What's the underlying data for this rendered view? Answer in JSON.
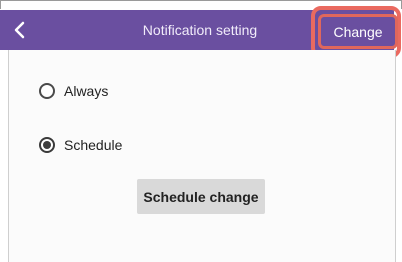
{
  "header": {
    "title": "Notification setting",
    "back_icon": "chevron-left-icon",
    "change_label": "Change",
    "bar_color": "#6a4fa0",
    "highlight_color": "#e0675c"
  },
  "options": {
    "always_label": "Always",
    "always_checked": false,
    "schedule_label": "Schedule",
    "schedule_checked": true
  },
  "schedule_change_label": "Schedule change"
}
